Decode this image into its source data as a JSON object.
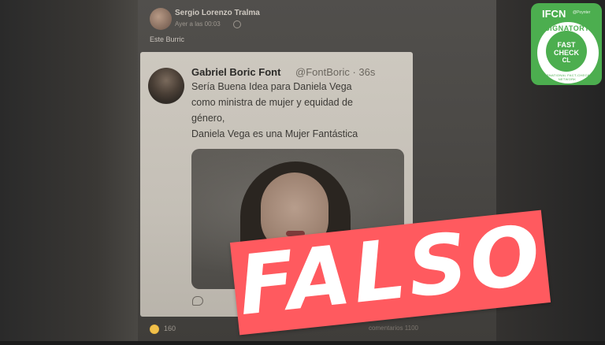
{
  "facebook_post": {
    "author": "Sergio Lorenzo Tralma",
    "timestamp": "Ayer a las 00:03",
    "text": "Este Burric",
    "reaction_count": "160",
    "comments_text": "comentarios 1100"
  },
  "tweet": {
    "author": "Gabriel Boric Font",
    "handle": "@FontBoric · 36s",
    "lines": [
      "Sería Buena Idea para Daniela Vega",
      "como ministra de mujer y equidad de",
      "género,",
      "Daniela Vega es una Mujer Fantástica"
    ]
  },
  "verdict": {
    "label": "FALSO",
    "color": "#ff5a5f"
  },
  "badge": {
    "ifcn": "IFCN",
    "poynter": "@Poynter",
    "signatory": "SIGNATORY",
    "fast": "FAST",
    "check": "CHECK",
    "cl": "CL",
    "network": "INTERNATIONAL FACT-CHECKING NETWORK",
    "color": "#4cae4f"
  }
}
